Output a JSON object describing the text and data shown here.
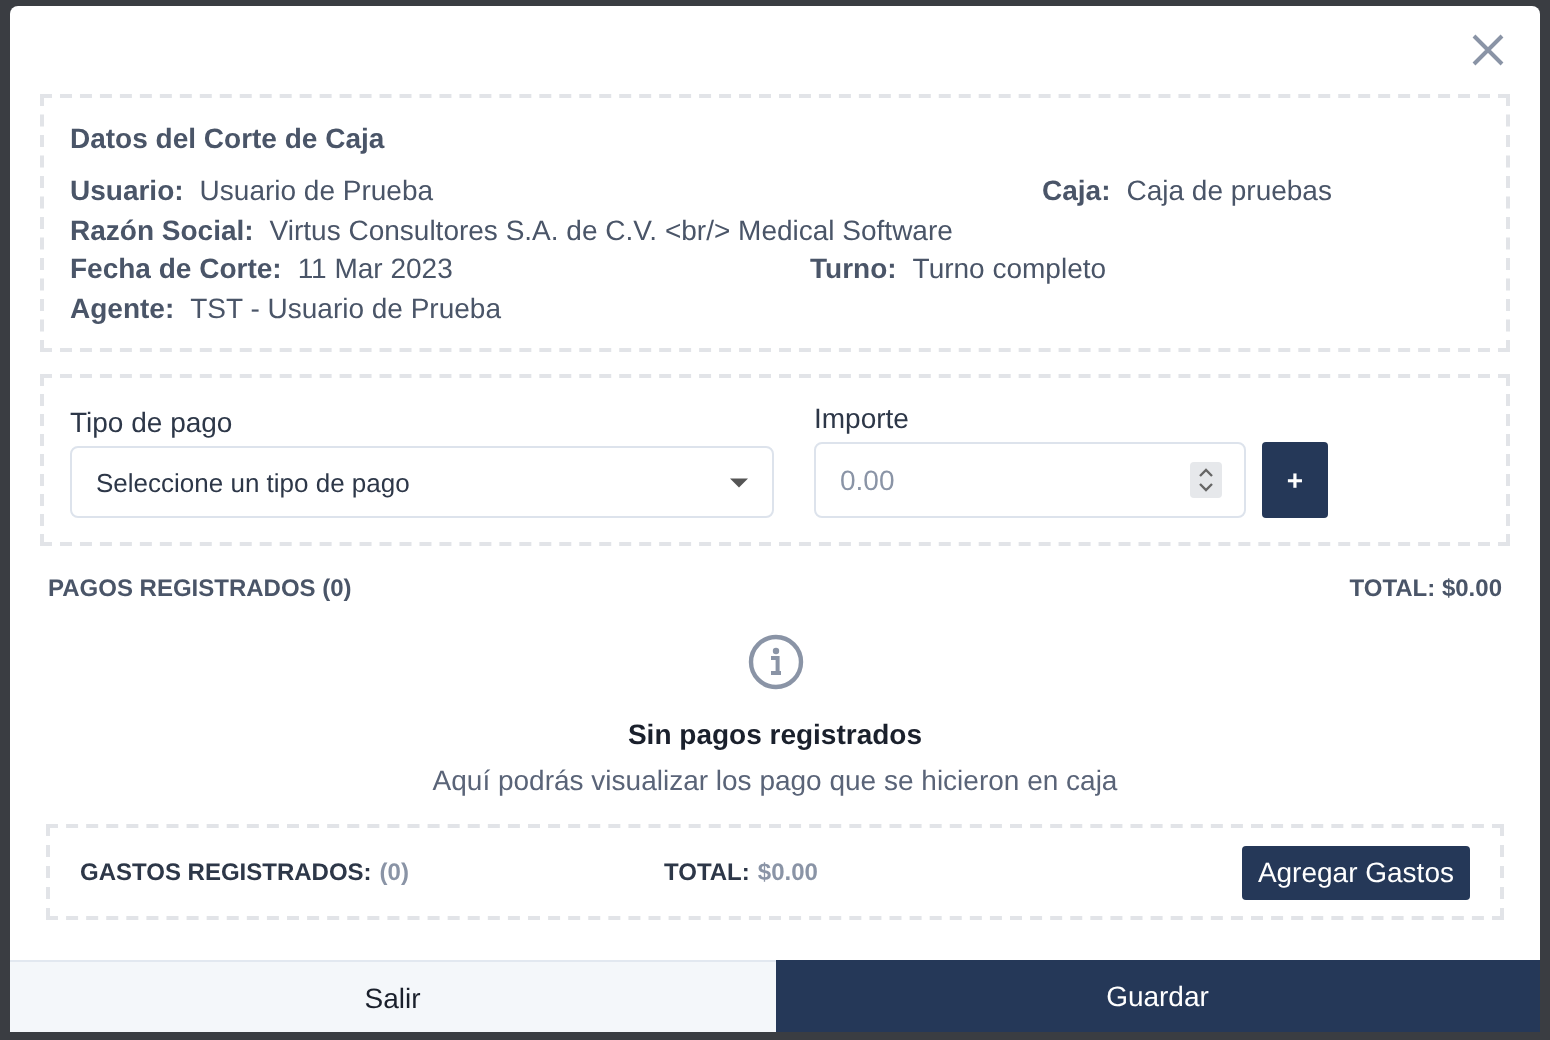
{
  "summary": {
    "title": "Datos del Corte de Caja",
    "rows": [
      [
        {
          "label": "Usuario:",
          "value": "Usuario de Prueba"
        },
        {
          "label": "Caja:",
          "value": "Caja de pruebas"
        }
      ],
      [
        {
          "label": "Razón Social:",
          "value": "Virtus Consultores S.A. de C.V. <br/> Medical Software"
        }
      ],
      [
        {
          "label": "Fecha de Corte:",
          "value": "11 Mar 2023"
        },
        {
          "label": "Turno:",
          "value": "Turno completo"
        }
      ],
      [
        {
          "label": "Agente:",
          "value": "TST - Usuario de Prueba"
        }
      ]
    ]
  },
  "payment_form": {
    "type_label": "Tipo de pago",
    "type_select": "Seleccione un tipo de pago",
    "amount_label": "Importe",
    "amount_placeholder": "0.00",
    "add_button": "+"
  },
  "payments": {
    "heading": "PAGOS REGISTRADOS (0)",
    "total": "TOTAL: $0.00",
    "empty_title": "Sin pagos registrados",
    "empty_message": "Aquí podrás visualizar los pago que se hicieron en caja"
  },
  "expenses": {
    "label": "GASTOS REGISTRADOS:",
    "count": "(0)",
    "total_label": "TOTAL:",
    "total_value": "$0.00",
    "button": "Agregar Gastos"
  },
  "footer": {
    "cancel": "Salir",
    "save": "Guardar"
  }
}
